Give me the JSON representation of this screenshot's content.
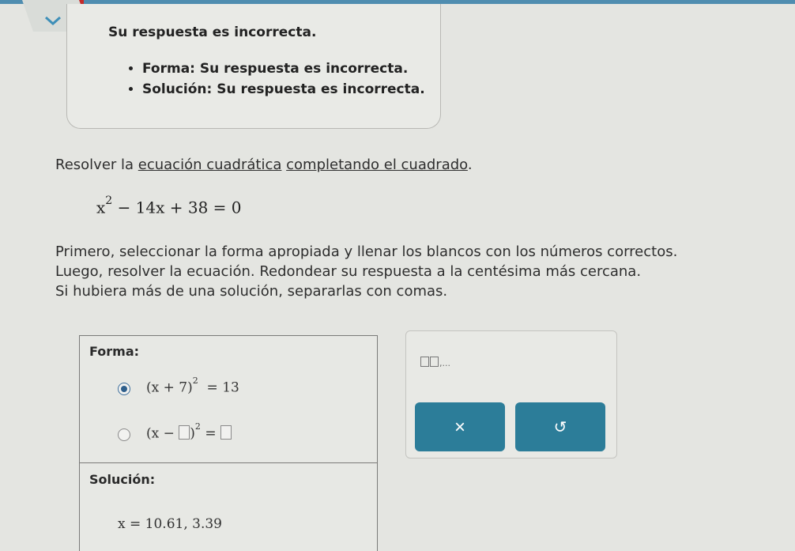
{
  "feedback": {
    "title": "Su respuesta es incorrecta.",
    "items": [
      "Forma: Su respuesta es incorrecta.",
      "Solución: Su respuesta es incorrecta."
    ]
  },
  "prompt": {
    "before": "Resolver la ",
    "link1": "ecuación cuadrática",
    "between": " ",
    "link2": "completando el cuadrado",
    "after": "."
  },
  "equation": {
    "base": "x",
    "exp": "2",
    "rest": "− 14x + 38 = 0"
  },
  "instructions": [
    "Primero, seleccionar la forma apropiada y llenar los blancos con los números correctos.",
    "Luego, resolver la ecuación. Redondear su respuesta a la centésima más cercana.",
    "Si hubiera más de una solución, separarlas con comas."
  ],
  "form": {
    "label": "Forma:",
    "option1": {
      "lhs": "(x + 7)",
      "exp": "2",
      "rhs": "= 13",
      "selected": true
    },
    "option2": {
      "lhs": "(x −",
      "close": ")",
      "exp": "2",
      "eq": "=",
      "selected": false
    }
  },
  "solution": {
    "label": "Solución:",
    "lhs": "x",
    "eq": "=",
    "value": "10.61, 3.39"
  },
  "tools": {
    "template": "□,□,...",
    "clear_symbol": "×",
    "undo_symbol": "↺"
  },
  "colors": {
    "accent": "#2c7d99",
    "topbar": "#4f8db0",
    "background": "#e4e5e1"
  }
}
